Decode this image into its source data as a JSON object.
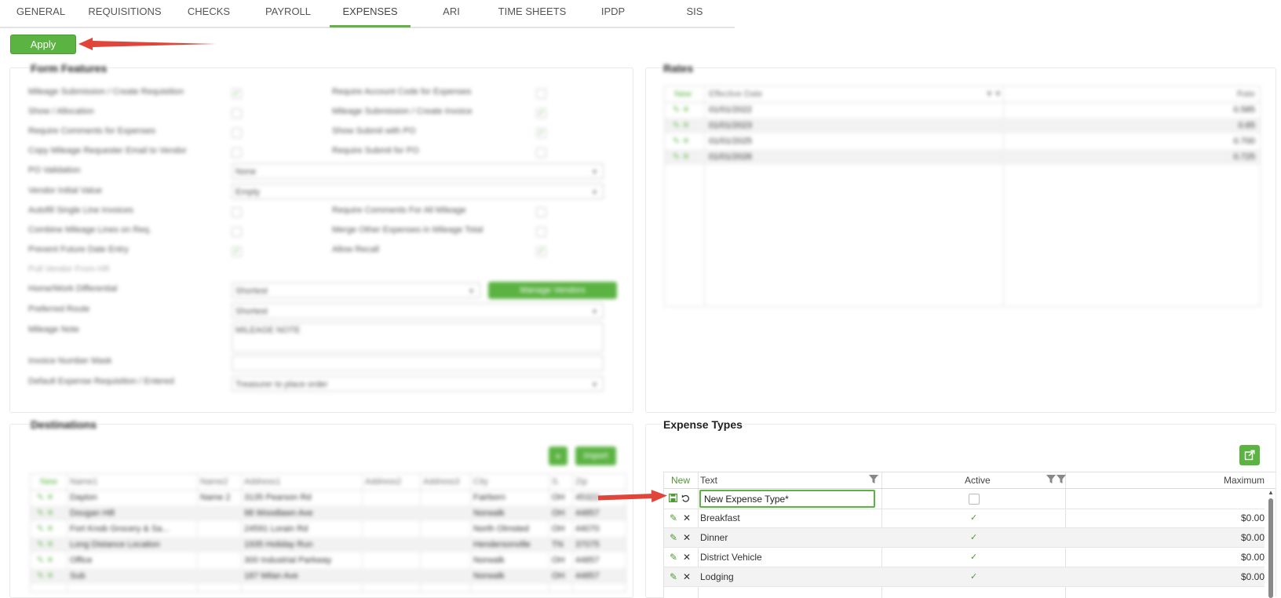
{
  "tabs": [
    {
      "label": "GENERAL",
      "active": false
    },
    {
      "label": "REQUISITIONS",
      "active": false
    },
    {
      "label": "CHECKS",
      "active": false
    },
    {
      "label": "PAYROLL",
      "active": false
    },
    {
      "label": "EXPENSES",
      "active": true
    },
    {
      "label": "ARI",
      "active": false
    },
    {
      "label": "TIME SHEETS",
      "active": false
    },
    {
      "label": "IPDP",
      "active": false
    },
    {
      "label": "SIS",
      "active": false
    }
  ],
  "apply_label": "Apply",
  "colors": {
    "accent": "#5bb342",
    "arrow": "#e0443a"
  },
  "form_features": {
    "title": "Form Features",
    "rows": [
      {
        "left": "Mileage Submission / Create Requisition",
        "left_checked": true,
        "right": "Require Account Code for Expenses",
        "right_checked": false
      },
      {
        "left": "Show / Allocation",
        "left_checked": false,
        "right": "Mileage Submission / Create Invoice",
        "right_checked": true
      },
      {
        "left": "Require Comments for Expenses",
        "left_checked": false,
        "right": "Show Submit with PO",
        "right_checked": true
      },
      {
        "left": "Copy Mileage Requester Email to Vendor",
        "left_checked": false,
        "right": "Require Submit for PO",
        "right_checked": false
      }
    ],
    "po_validation": {
      "label": "PO Validation",
      "value": "None"
    },
    "vendor_initial": {
      "label": "Vendor Initial Value",
      "value": "Empty"
    },
    "rows2": [
      {
        "left": "Autofill Single Line Invoices",
        "left_checked": false,
        "right": "Require Comments For All Mileage",
        "right_checked": false
      },
      {
        "left": "Combine Mileage Lines on Req.",
        "left_checked": false,
        "right": "Merge Other Expenses in Mileage Total",
        "right_checked": false
      },
      {
        "left": "Prevent Future Date Entry",
        "left_checked": true,
        "right": "Allow Recall",
        "right_checked": true
      }
    ],
    "pull_hours": {
      "label": "Pull Vendor From HR"
    },
    "home_work": {
      "label": "Home/Work Differential",
      "value": "Shortest",
      "button": "Manage Vendors"
    },
    "preferred_route": {
      "label": "Preferred Route",
      "value": "Shortest"
    },
    "mileage_note": {
      "label": "Mileage Note",
      "value": "MILEAGE NOTE"
    },
    "invoice_mask": {
      "label": "Invoice Number Mask",
      "value": ""
    },
    "default_expense": {
      "label": "Default Expense Requisition / Entered",
      "value": "Treasurer to place order"
    }
  },
  "rates": {
    "title": "Rates",
    "headers": [
      "New",
      "Effective Date",
      "Rate"
    ],
    "rows": [
      {
        "date": "01/01/2022",
        "rate": "0.585"
      },
      {
        "date": "01/01/2023",
        "rate": "0.65"
      },
      {
        "date": "01/01/2025",
        "rate": "0.700"
      },
      {
        "date": "01/01/2026",
        "rate": "0.725"
      }
    ]
  },
  "destinations": {
    "title": "Destinations",
    "import_label": "Import",
    "headers": [
      "New",
      "Name1",
      "Name2",
      "Address1",
      "Address2",
      "Address3",
      "City",
      "S.",
      "Zip"
    ],
    "rows": [
      {
        "name1": "Dayton",
        "name2": "Name 2",
        "address1": "3135 Pearson Rd",
        "city": "Fairborn",
        "state": "OH",
        "zip": "45322"
      },
      {
        "name1": "Dougan Hill",
        "name2": "",
        "address1": "98 Woodlawn Ave",
        "city": "Norwalk",
        "state": "OH",
        "zip": "44857"
      },
      {
        "name1": "Fort Knob Grocery & Sa...",
        "name2": "",
        "address1": "24591 Lorain Rd",
        "city": "North Olmsted",
        "state": "OH",
        "zip": "44070"
      },
      {
        "name1": "Long Distance Location",
        "name2": "",
        "address1": "1935 Holiday Run",
        "city": "Hendersonville",
        "state": "TN",
        "zip": "37075"
      },
      {
        "name1": "Office",
        "name2": "",
        "address1": "300 Industrial Parkway",
        "city": "Norwalk",
        "state": "OH",
        "zip": "44857"
      },
      {
        "name1": "Sub",
        "name2": "",
        "address1": "187 Milan Ave",
        "city": "Norwalk",
        "state": "OH",
        "zip": "44857"
      }
    ]
  },
  "expense_types": {
    "title": "Expense Types",
    "headers": {
      "new": "New",
      "text": "Text",
      "active": "Active",
      "maximum": "Maximum"
    },
    "new_row": {
      "text_value": "New Expense Type*",
      "active": false
    },
    "rows": [
      {
        "text": "Breakfast",
        "active": true,
        "maximum": "$0.00"
      },
      {
        "text": "Dinner",
        "active": true,
        "maximum": "$0.00"
      },
      {
        "text": "District Vehicle",
        "active": true,
        "maximum": "$0.00"
      },
      {
        "text": "Lodging",
        "active": true,
        "maximum": "$0.00"
      }
    ]
  }
}
